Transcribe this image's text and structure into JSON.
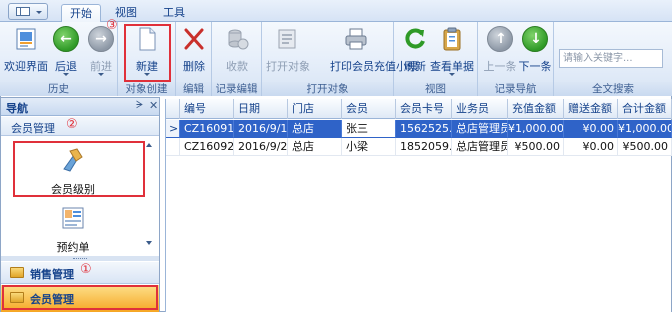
{
  "tabs": [
    "开始",
    "视图",
    "工具"
  ],
  "ribbon": {
    "groups": [
      {
        "label": "历史",
        "buttons": [
          {
            "label": "欢迎界面"
          },
          {
            "label": "后退"
          },
          {
            "label": "前进"
          }
        ]
      },
      {
        "label": "对象创建",
        "buttons": [
          {
            "label": "新建"
          }
        ]
      },
      {
        "label": "编辑",
        "buttons": [
          {
            "label": "删除"
          }
        ]
      },
      {
        "label": "记录编辑",
        "buttons": [
          {
            "label": "收款"
          }
        ]
      },
      {
        "label": "打开对象",
        "buttons": [
          {
            "label": "打开对象"
          },
          {
            "label": "打印会员充值小票"
          }
        ]
      },
      {
        "label": "视图",
        "buttons": [
          {
            "label": "刷新"
          },
          {
            "label": "查看单据"
          }
        ]
      },
      {
        "label": "记录导航",
        "buttons": [
          {
            "label": "上一条"
          },
          {
            "label": "下一条"
          }
        ]
      },
      {
        "label": "全文搜索",
        "search_placeholder": "请输入关键字..."
      }
    ]
  },
  "markers": {
    "one": "①",
    "two": "②",
    "three": "③"
  },
  "nav": {
    "title": "导航",
    "pin": "ᗒ",
    "close": "✕",
    "current_group": "会员管理",
    "items": [
      {
        "label": "会员级别"
      },
      {
        "label": "预约单"
      }
    ],
    "groups": [
      {
        "label": "销售管理"
      },
      {
        "label": "会员管理"
      }
    ]
  },
  "grid": {
    "columns": [
      "编号",
      "日期",
      "门店",
      "会员",
      "会员卡号",
      "业务员",
      "充值金额",
      "赠送金额",
      "合计金额"
    ],
    "rows": [
      {
        "indicator": ">",
        "cells": [
          "CZ16091...",
          "2016/9/13",
          "总店",
          "张三",
          "1562525...",
          "总店管理员",
          "¥1,000.00",
          "¥0.00",
          "¥1,000.00"
        ]
      },
      {
        "indicator": "",
        "cells": [
          "CZ16092...",
          "2016/9/21",
          "总店",
          "小梁",
          "1852059...",
          "总店管理员",
          "¥500.00",
          "¥0.00",
          "¥500.00"
        ]
      }
    ]
  },
  "colors": {
    "selected_row": "#2f63c8",
    "highlight": "#e0303a",
    "active_nav_group": "#f6a623"
  }
}
